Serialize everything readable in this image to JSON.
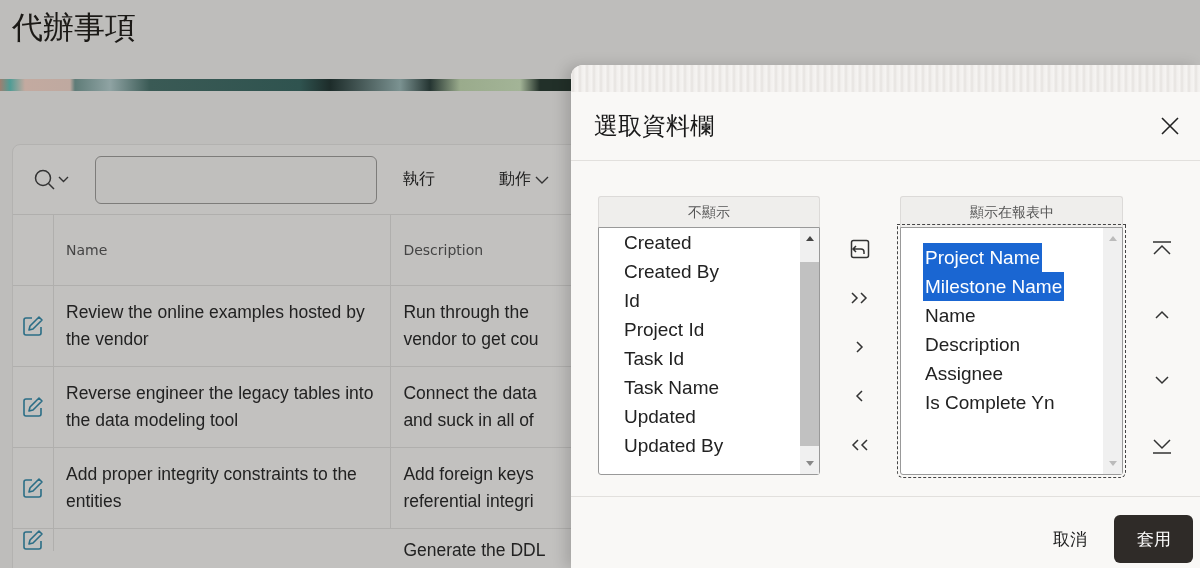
{
  "page": {
    "title": "代辦事項"
  },
  "toolbar": {
    "go_button": "執行",
    "actions_menu": "動作"
  },
  "table": {
    "columns": [
      "Name",
      "Description"
    ],
    "rows": [
      {
        "name": "Review the online examples hosted by the vendor",
        "description": [
          "Run through the",
          "vendor to get cou"
        ]
      },
      {
        "name": "Reverse engineer the legacy tables into the data modeling tool",
        "description": [
          "Connect the data",
          "and suck in all of"
        ]
      },
      {
        "name": "Add proper integrity constraints to the entities",
        "description": [
          "Add foreign keys",
          "referential integri"
        ]
      },
      {
        "name": "",
        "description": [
          "Generate the DDL"
        ]
      }
    ]
  },
  "dialog": {
    "title": "選取資料欄",
    "hidden_list": {
      "header": "不顯示",
      "items": [
        {
          "label": "Created",
          "selected": false
        },
        {
          "label": "Created By",
          "selected": false
        },
        {
          "label": "Id",
          "selected": false
        },
        {
          "label": "Project Id",
          "selected": false
        },
        {
          "label": "Task Id",
          "selected": false
        },
        {
          "label": "Task Name",
          "selected": false
        },
        {
          "label": "Updated",
          "selected": false
        },
        {
          "label": "Updated By",
          "selected": false
        }
      ]
    },
    "shown_list": {
      "header": "顯示在報表中",
      "items": [
        {
          "label": "Project Name",
          "selected": true
        },
        {
          "label": "Milestone Name",
          "selected": true
        },
        {
          "label": "Name",
          "selected": false
        },
        {
          "label": "Description",
          "selected": false
        },
        {
          "label": "Assignee",
          "selected": false
        },
        {
          "label": "Is Complete Yn",
          "selected": false
        }
      ]
    },
    "move_buttons": [
      {
        "kind": "reset"
      },
      {
        "kind": "all-right"
      },
      {
        "kind": "right"
      },
      {
        "kind": "left"
      },
      {
        "kind": "all-left"
      }
    ],
    "order_buttons": [
      {
        "kind": "top"
      },
      {
        "kind": "up"
      },
      {
        "kind": "down"
      },
      {
        "kind": "bottom"
      }
    ],
    "footer": {
      "cancel": "取消",
      "apply": "套用"
    }
  }
}
